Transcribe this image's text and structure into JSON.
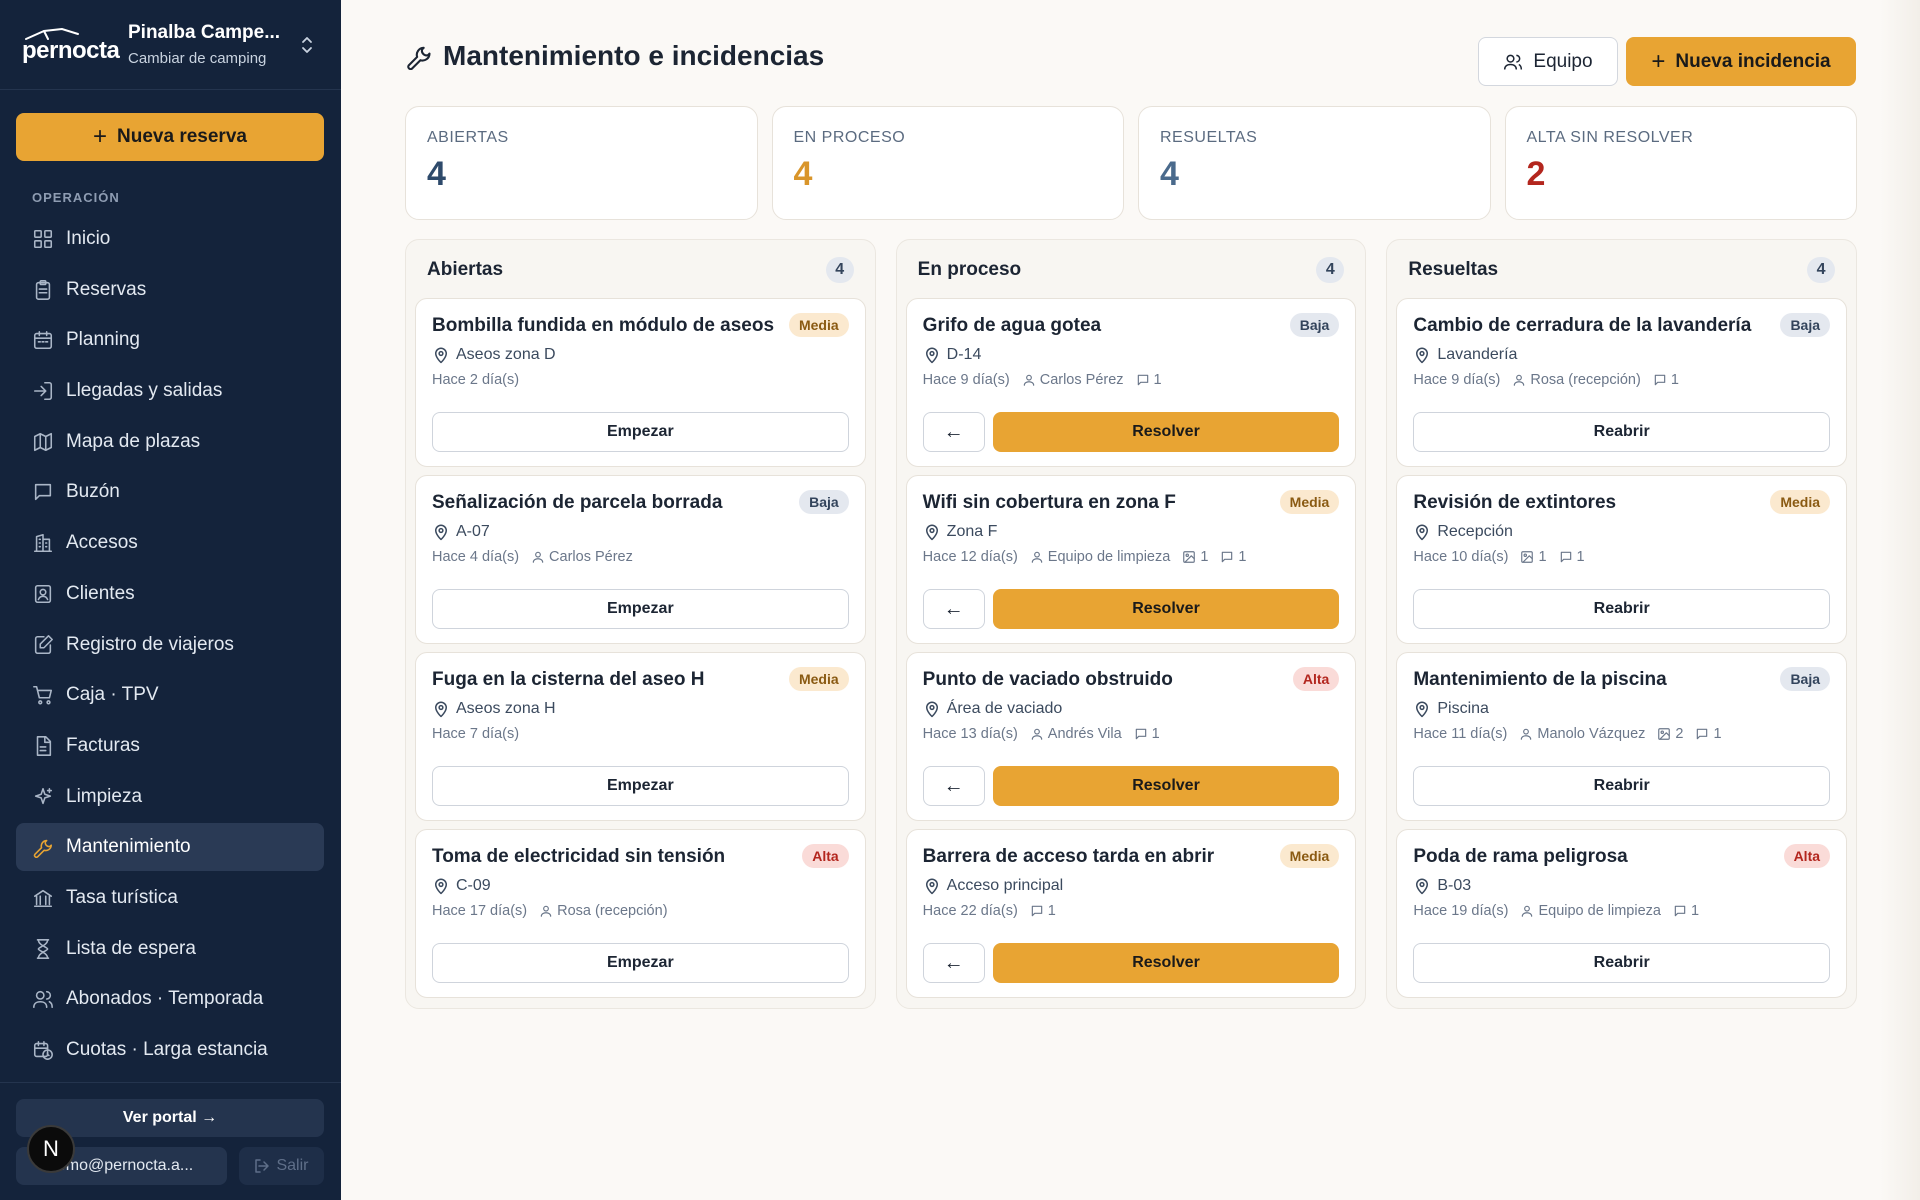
{
  "brand": {
    "logo_text": "pernocta",
    "camp_name": "Pinalba Campe...",
    "camp_sub": "Cambiar de camping"
  },
  "sidebar": {
    "new_reservation": "Nueva reserva",
    "section": "OPERACIÓN",
    "items": [
      {
        "label": "Inicio",
        "icon": "grid-icon"
      },
      {
        "label": "Reservas",
        "icon": "clipboard-icon"
      },
      {
        "label": "Planning",
        "icon": "calendar-icon"
      },
      {
        "label": "Llegadas y salidas",
        "icon": "login-icon"
      },
      {
        "label": "Mapa de plazas",
        "icon": "map-icon"
      },
      {
        "label": "Buzón",
        "icon": "message-icon"
      },
      {
        "label": "Accesos",
        "icon": "building-icon"
      },
      {
        "label": "Clientes",
        "icon": "contact-icon"
      },
      {
        "label": "Registro de viajeros",
        "icon": "edit-icon"
      },
      {
        "label": "Caja · TPV",
        "icon": "cart-icon"
      },
      {
        "label": "Facturas",
        "icon": "file-icon"
      },
      {
        "label": "Limpieza",
        "icon": "sparkle-icon"
      },
      {
        "label": "Mantenimiento",
        "icon": "wrench-icon",
        "active": true
      },
      {
        "label": "Tasa turística",
        "icon": "bank-icon"
      },
      {
        "label": "Lista de espera",
        "icon": "hourglass-icon"
      },
      {
        "label": "Abonados · Temporada",
        "icon": "users-icon"
      },
      {
        "label": "Cuotas · Larga estancia",
        "icon": "calendar-clock-icon"
      }
    ],
    "portal": "Ver portal →",
    "user_email": "demo@pernocta.a...",
    "logout": "Salir",
    "avatar_letter": "N"
  },
  "header": {
    "title": "Mantenimiento e incidencias",
    "team_button": "Equipo",
    "new_button": "Nueva incidencia"
  },
  "stats": [
    {
      "label": "ABIERTAS",
      "value": "4",
      "color": "#2e4a6b"
    },
    {
      "label": "EN PROCESO",
      "value": "4",
      "color": "#d9952a"
    },
    {
      "label": "RESUELTAS",
      "value": "4",
      "color": "#4a6a8c"
    },
    {
      "label": "ALTA SIN RESOLVER",
      "value": "2",
      "color": "#b3261e"
    }
  ],
  "columns": [
    {
      "title": "Abiertas",
      "count": "4",
      "mode": "open",
      "cards": [
        {
          "title": "Bombilla fundida en módulo de aseos",
          "priority": "Media",
          "location": "Aseos zona D",
          "age": "Hace 2 día(s)",
          "assignee": "",
          "photos": "",
          "comments": "",
          "action": "Empezar"
        },
        {
          "title": "Señalización de parcela borrada",
          "priority": "Baja",
          "location": "A-07",
          "age": "Hace 4 día(s)",
          "assignee": "Carlos Pérez",
          "photos": "",
          "comments": "",
          "action": "Empezar"
        },
        {
          "title": "Fuga en la cisterna del aseo H",
          "priority": "Media",
          "location": "Aseos zona H",
          "age": "Hace 7 día(s)",
          "assignee": "",
          "photos": "",
          "comments": "",
          "action": "Empezar"
        },
        {
          "title": "Toma de electricidad sin tensión",
          "priority": "Alta",
          "location": "C-09",
          "age": "Hace 17 día(s)",
          "assignee": "Rosa (recepción)",
          "photos": "",
          "comments": "",
          "action": "Empezar"
        }
      ]
    },
    {
      "title": "En proceso",
      "count": "4",
      "mode": "progress",
      "cards": [
        {
          "title": "Grifo de agua gotea",
          "priority": "Baja",
          "location": "D-14",
          "age": "Hace 9 día(s)",
          "assignee": "Carlos Pérez",
          "photos": "",
          "comments": "1",
          "back": "←",
          "action": "Resolver"
        },
        {
          "title": "Wifi sin cobertura en zona F",
          "priority": "Media",
          "location": "Zona F",
          "age": "Hace 12 día(s)",
          "assignee": "Equipo de limpieza",
          "photos": "1",
          "comments": "1",
          "back": "←",
          "action": "Resolver"
        },
        {
          "title": "Punto de vaciado obstruido",
          "priority": "Alta",
          "location": "Área de vaciado",
          "age": "Hace 13 día(s)",
          "assignee": "Andrés Vila",
          "photos": "",
          "comments": "1",
          "back": "←",
          "action": "Resolver"
        },
        {
          "title": "Barrera de acceso tarda en abrir",
          "priority": "Media",
          "location": "Acceso principal",
          "age": "Hace 22 día(s)",
          "assignee": "",
          "photos": "",
          "comments": "1",
          "back": "←",
          "action": "Resolver"
        }
      ]
    },
    {
      "title": "Resueltas",
      "count": "4",
      "mode": "done",
      "cards": [
        {
          "title": "Cambio de cerradura de la lavandería",
          "priority": "Baja",
          "location": "Lavandería",
          "age": "Hace 9 día(s)",
          "assignee": "Rosa (recepción)",
          "photos": "",
          "comments": "1",
          "action": "Reabrir"
        },
        {
          "title": "Revisión de extintores",
          "priority": "Media",
          "location": "Recepción",
          "age": "Hace 10 día(s)",
          "assignee": "",
          "photos": "1",
          "comments": "1",
          "action": "Reabrir"
        },
        {
          "title": "Mantenimiento de la piscina",
          "priority": "Baja",
          "location": "Piscina",
          "age": "Hace 11 día(s)",
          "assignee": "Manolo Vázquez",
          "photos": "2",
          "comments": "1",
          "action": "Reabrir"
        },
        {
          "title": "Poda de rama peligrosa",
          "priority": "Alta",
          "location": "B-03",
          "age": "Hace 19 día(s)",
          "assignee": "Equipo de limpieza",
          "photos": "",
          "comments": "1",
          "action": "Reabrir"
        }
      ]
    }
  ]
}
